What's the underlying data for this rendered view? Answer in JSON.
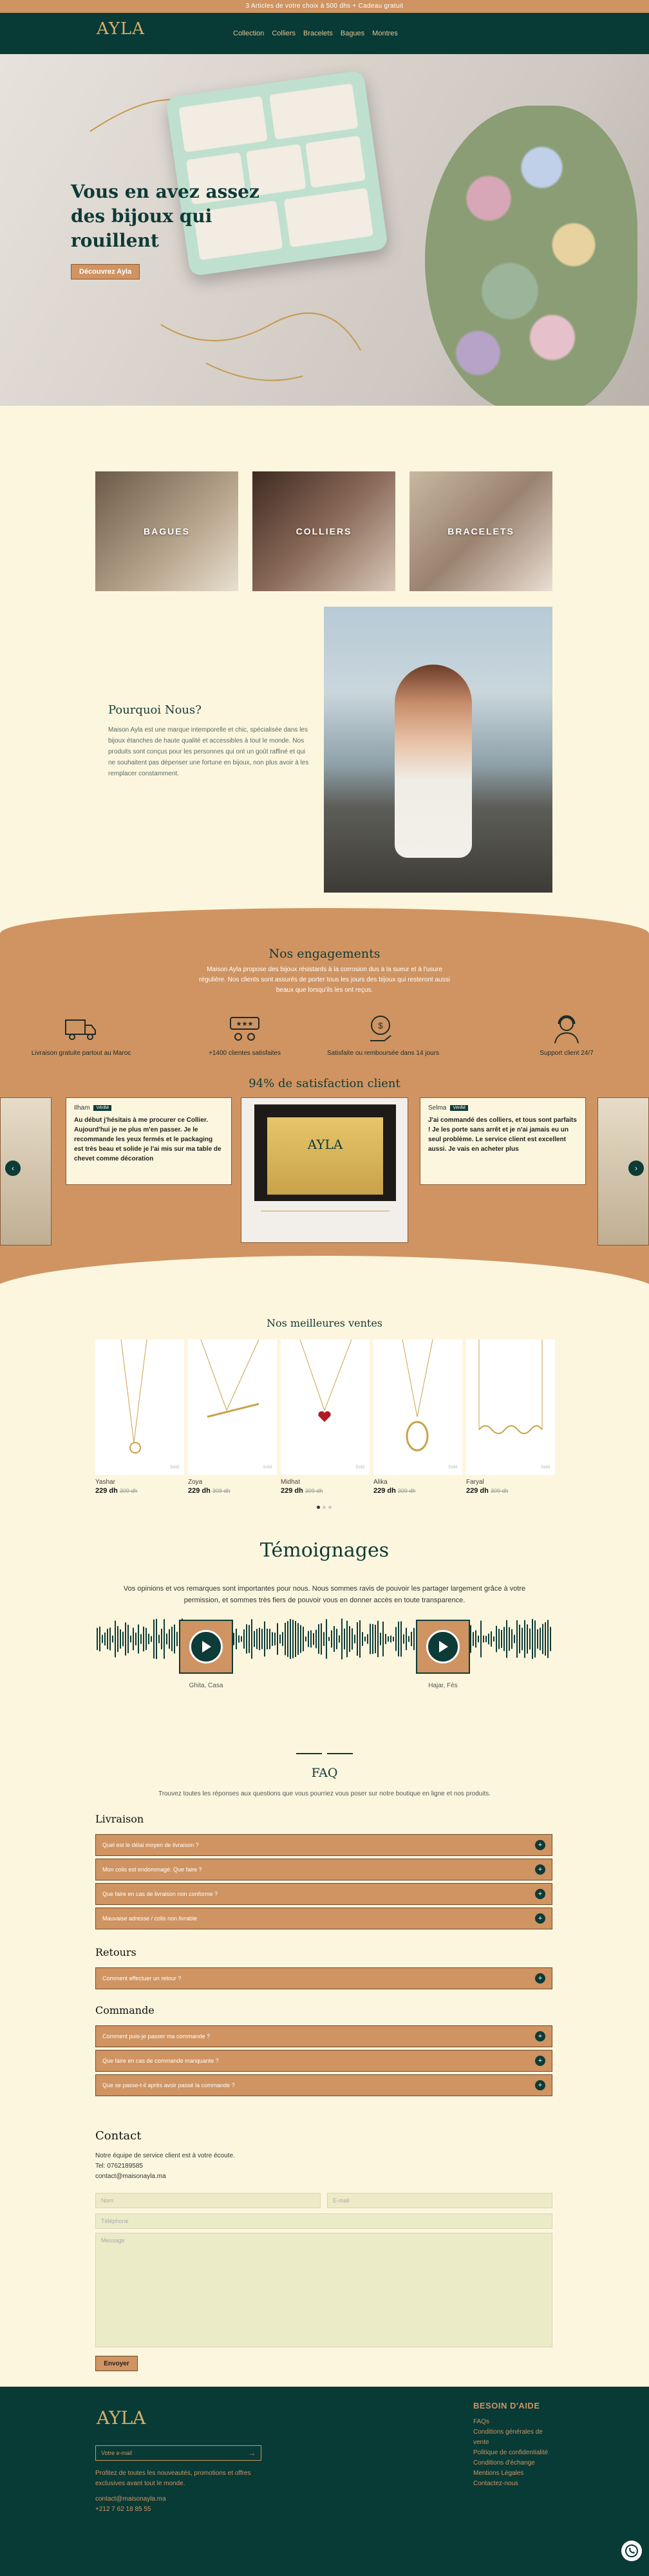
{
  "topbar": {
    "text": "3 Articles de votre choix à 500 dhs + Cadeau gratuit"
  },
  "header": {
    "logo": "AYLA",
    "nav": [
      "Collection",
      "Colliers",
      "Bracelets",
      "Bagues",
      "Montres"
    ]
  },
  "hero": {
    "title": "Vous en avez assez des bijoux qui rouillent",
    "cta": "Découvrez Ayla"
  },
  "categories": [
    "BAGUES",
    "COLLIERS",
    "BRACELETS"
  ],
  "why": {
    "title": "Pourquoi Nous?",
    "text": "Maison Ayla est une marque intemporelle et chic, spécialisée dans les bijoux étanches de haute qualité et accessibles à tout le monde. Nos produits sont conçus pour les personnes qui ont un goût raffiné et qui ne souhaitent pas dépenser une fortune en bijoux, non plus avoir à les remplacer constamment."
  },
  "engagements": {
    "title": "Nos engagements",
    "text": "Maison Ayla propose des bijoux résistants à la corrosion dus à la sueur et à l'usure régulière. Nos clients sont assurés de porter tous les jours des bijoux qui resteront aussi beaux que lorsqu'ils les ont reçus.",
    "features": [
      {
        "icon": "truck-icon",
        "label": "Livraison gratuite partout au Maroc"
      },
      {
        "icon": "stars-review-icon",
        "label": "+1400 clientes satisfaites"
      },
      {
        "icon": "money-back-icon",
        "label": "Satisfaite ou remboursée dans 14 jours"
      },
      {
        "icon": "support-agent-icon",
        "label": "Support client 24/7"
      }
    ]
  },
  "satisfaction": {
    "title": "94% de satisfaction client",
    "reviews": [
      {
        "name": "Ilham",
        "badge": "Vérifié",
        "text": "Au début j'hésitais à me procurer ce Collier. Aujourd'hui je ne plus m'en passer. Je le recommande les yeux fermés et le packaging est très beau et solide je l'ai mis sur ma table de chevet comme décoration"
      },
      {
        "name": "Selma",
        "badge": "Vérifié",
        "text": "J'ai commandé des colliers, et tous sont parfaits ! Je les porte sans arrêt et je n'ai jamais eu un seul problème. Le service client est excellent aussi. Je vais en acheter plus"
      }
    ],
    "prev": "‹",
    "next": "›"
  },
  "bestsellers": {
    "title": "Nos meilleures ventes",
    "products": [
      {
        "name": "Yashar",
        "price": "229 dh",
        "old": "309 dh"
      },
      {
        "name": "Zoya",
        "price": "229 dh",
        "old": "309 dh"
      },
      {
        "name": "Midhat",
        "price": "229 dh",
        "old": "309 dh"
      },
      {
        "name": "Alika",
        "price": "229 dh",
        "old": "309 dh"
      },
      {
        "name": "Faryal",
        "price": "229 dh",
        "old": "309 dh"
      }
    ],
    "sold": "Sold"
  },
  "testimonials": {
    "title": "Témoignages",
    "text": "Vos opinions et vos remarques sont importantes pour nous. Nous sommes ravis de pouvoir les partager largement grâce à votre permission, et sommes très fiers de pouvoir vous en donner accès en toute transparence.",
    "audios": [
      "Ghita, Casa",
      "Hajar, Fès"
    ]
  },
  "faq": {
    "title": "FAQ",
    "subtitle": "Trouvez toutes les réponses aux questions que vous pourriez vous poser sur notre boutique en ligne et nos produits.",
    "sections": [
      {
        "title": "Livraison",
        "questions": [
          "Quel est le délai moyen de livraison ?",
          "Mon colis est endommagé. Que faire ?",
          "Que faire en cas de livraison non conforme ?",
          "Mauvaise adresse / colis non livrable"
        ]
      },
      {
        "title": "Retours",
        "questions": [
          "Comment effectuer un retour ?"
        ]
      },
      {
        "title": "Commande",
        "questions": [
          "Comment puis-je passer ma commande ?",
          "Que faire en cas de commande manquante ?",
          "Que se passe-t-il après avoir passé la commande ?"
        ]
      }
    ]
  },
  "contact": {
    "title": "Contact",
    "lines": [
      "Notre équipe de service client est à votre écoute.",
      "Tel: 0762189585",
      "contact@maisonayla.ma"
    ],
    "placeholders": {
      "name": "Nom",
      "email": "E-mail",
      "phone": "Téléphone",
      "message": "Message"
    },
    "send": "Envoyer"
  },
  "footer": {
    "logo": "AYLA",
    "email_placeholder": "Votre e-mail",
    "promo": "Profitez de toutes les nouveautés, promotions et offres exclusives avant tout le monde.",
    "email": "contact@maisonayla.ma",
    "phone": "+212 7 62 18 85 55",
    "help_title": "BESOIN D'AIDE",
    "help_links": [
      "FAQs",
      "Conditions générales de vente",
      "Politique de confidentialité",
      "Conditions d'échange",
      "Mentions Légales",
      "Contactez-nous"
    ]
  }
}
